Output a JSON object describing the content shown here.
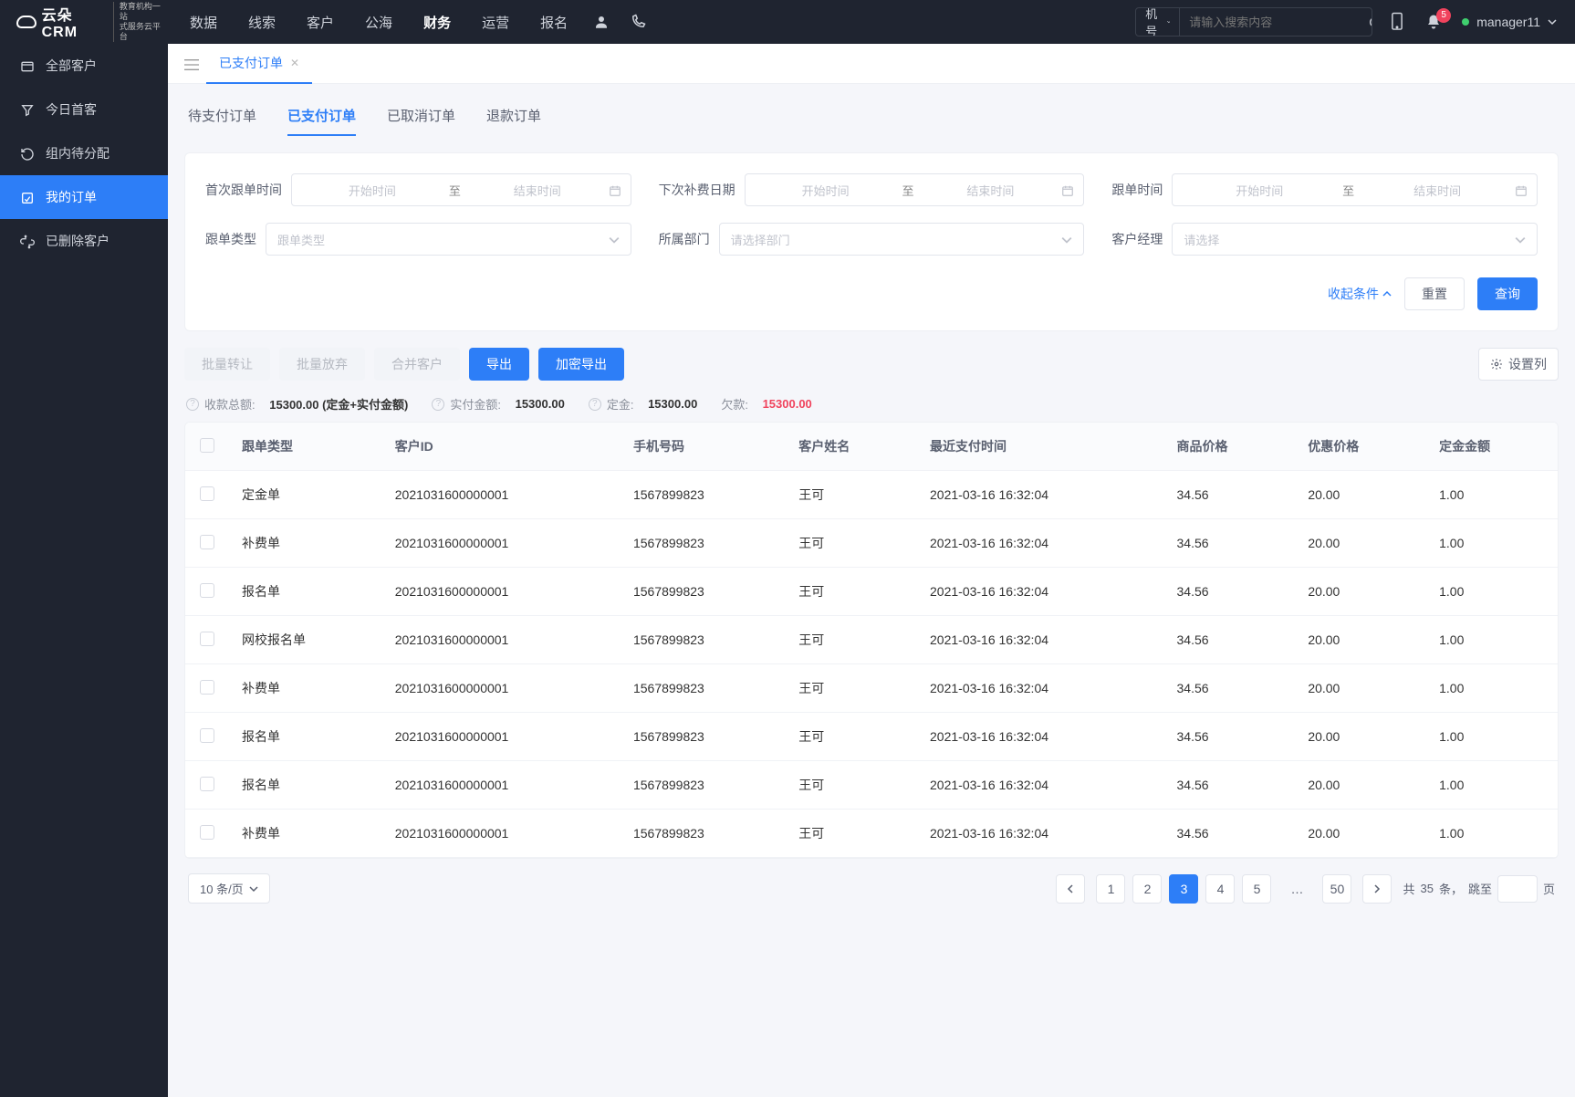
{
  "brand": {
    "name": "云朵CRM",
    "subline1": "教育机构一站",
    "subline2": "式服务云平台"
  },
  "topnav": {
    "items": [
      "数据",
      "线索",
      "客户",
      "公海",
      "财务",
      "运营",
      "报名"
    ],
    "active_index": 4
  },
  "search": {
    "category": "手机号码",
    "placeholder": "请输入搜索内容"
  },
  "notifications": {
    "count": "5"
  },
  "user": {
    "name": "manager11"
  },
  "sidebar": {
    "items": [
      {
        "label": "全部客户"
      },
      {
        "label": "今日首客"
      },
      {
        "label": "组内待分配"
      },
      {
        "label": "我的订单"
      },
      {
        "label": "已删除客户"
      }
    ],
    "active_index": 3
  },
  "tabsbar": {
    "tabs": [
      {
        "label": "已支付订单"
      }
    ],
    "active_index": 0
  },
  "subtabs": {
    "items": [
      "待支付订单",
      "已支付订单",
      "已取消订单",
      "退款订单"
    ],
    "active_index": 1
  },
  "filters": {
    "row1": [
      {
        "label": "首次跟单时间",
        "start_ph": "开始时间",
        "sep": "至",
        "end_ph": "结束时间"
      },
      {
        "label": "下次补费日期",
        "start_ph": "开始时间",
        "sep": "至",
        "end_ph": "结束时间"
      },
      {
        "label": "跟单时间",
        "start_ph": "开始时间",
        "sep": "至",
        "end_ph": "结束时间"
      }
    ],
    "row2": [
      {
        "label": "跟单类型",
        "placeholder": "跟单类型"
      },
      {
        "label": "所属部门",
        "placeholder": "请选择部门"
      },
      {
        "label": "客户经理",
        "placeholder": "请选择"
      }
    ],
    "collapse": "收起条件",
    "reset": "重置",
    "query": "查询"
  },
  "toolbar": {
    "batch_transfer": "批量转让",
    "batch_abandon": "批量放弃",
    "merge_customer": "合并客户",
    "export": "导出",
    "encrypt_export": "加密导出",
    "column_settings": "设置列"
  },
  "summary": {
    "k1_label": "收款总额:",
    "k1_value": "15300.00 (定金+实付金额)",
    "k2_label": "实付金额:",
    "k2_value": "15300.00",
    "k3_label": "定金:",
    "k3_value": "15300.00",
    "k4_label": "欠款:",
    "k4_value": "15300.00"
  },
  "table": {
    "headers": [
      "跟单类型",
      "客户ID",
      "手机号码",
      "客户姓名",
      "最近支付时间",
      "商品价格",
      "优惠价格",
      "定金金额"
    ],
    "rows": [
      {
        "type": "定金单",
        "cid": "2021031600000001",
        "phone": "1567899823",
        "name": "王可",
        "paid_at": "2021-03-16 16:32:04",
        "price": "34.56",
        "disc": "20.00",
        "deposit": "1.00"
      },
      {
        "type": "补费单",
        "cid": "2021031600000001",
        "phone": "1567899823",
        "name": "王可",
        "paid_at": "2021-03-16 16:32:04",
        "price": "34.56",
        "disc": "20.00",
        "deposit": "1.00"
      },
      {
        "type": "报名单",
        "cid": "2021031600000001",
        "phone": "1567899823",
        "name": "王可",
        "paid_at": "2021-03-16 16:32:04",
        "price": "34.56",
        "disc": "20.00",
        "deposit": "1.00"
      },
      {
        "type": "网校报名单",
        "cid": "2021031600000001",
        "phone": "1567899823",
        "name": "王可",
        "paid_at": "2021-03-16 16:32:04",
        "price": "34.56",
        "disc": "20.00",
        "deposit": "1.00"
      },
      {
        "type": "补费单",
        "cid": "2021031600000001",
        "phone": "1567899823",
        "name": "王可",
        "paid_at": "2021-03-16 16:32:04",
        "price": "34.56",
        "disc": "20.00",
        "deposit": "1.00"
      },
      {
        "type": "报名单",
        "cid": "2021031600000001",
        "phone": "1567899823",
        "name": "王可",
        "paid_at": "2021-03-16 16:32:04",
        "price": "34.56",
        "disc": "20.00",
        "deposit": "1.00"
      },
      {
        "type": "报名单",
        "cid": "2021031600000001",
        "phone": "1567899823",
        "name": "王可",
        "paid_at": "2021-03-16 16:32:04",
        "price": "34.56",
        "disc": "20.00",
        "deposit": "1.00"
      },
      {
        "type": "补费单",
        "cid": "2021031600000001",
        "phone": "1567899823",
        "name": "王可",
        "paid_at": "2021-03-16 16:32:04",
        "price": "34.56",
        "disc": "20.00",
        "deposit": "1.00"
      }
    ]
  },
  "pager": {
    "pagesize": "10 条/页",
    "pages_shown": [
      "1",
      "2",
      "3",
      "4",
      "5"
    ],
    "active_page": "3",
    "last_page": "50",
    "total_prefix": "共",
    "total_count": "35",
    "total_suffix": "条，",
    "jump_label": "跳至",
    "page_suffix": "页"
  }
}
